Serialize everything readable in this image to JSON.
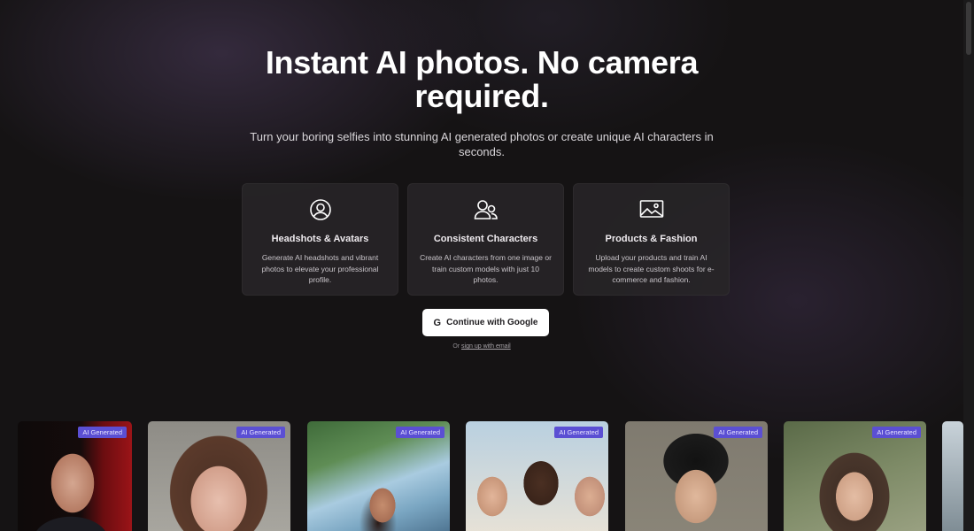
{
  "hero": {
    "title": "Instant AI photos. No camera required.",
    "subtitle": "Turn your boring selfies into stunning AI generated photos or create unique AI characters in seconds."
  },
  "features": [
    {
      "icon": "user-circle-icon",
      "title": "Headshots & Avatars",
      "description": "Generate AI headshots and vibrant photos to elevate your professional profile."
    },
    {
      "icon": "users-icon",
      "title": "Consistent Characters",
      "description": "Create AI characters from one image or train custom models with just 10 photos."
    },
    {
      "icon": "image-icon",
      "title": "Products & Fashion",
      "description": "Upload your products and train AI models to create custom shoots for e-commerce and fashion."
    }
  ],
  "auth": {
    "google_label": "Continue with Google",
    "google_icon": "google-g-icon",
    "alt_prefix": "Or",
    "email_link": "sign up with email"
  },
  "gallery": {
    "badge_label": "AI Generated",
    "badge_color": "#5b4fd3"
  }
}
